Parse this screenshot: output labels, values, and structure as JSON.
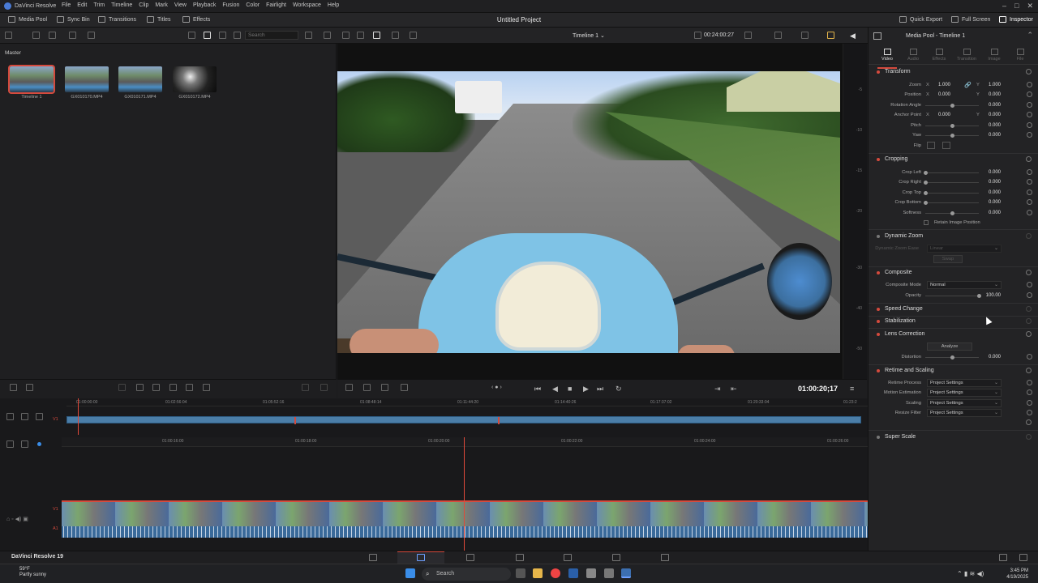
{
  "app": {
    "name": "DaVinci Resolve",
    "project_title": "Untitled Project"
  },
  "menu": [
    "File",
    "Edit",
    "Trim",
    "Timeline",
    "Clip",
    "Mark",
    "View",
    "Playback",
    "Fusion",
    "Color",
    "Fairlight",
    "Workspace",
    "Help"
  ],
  "toolbar": {
    "media_pool": "Media Pool",
    "sync_bin": "Sync Bin",
    "transitions": "Transitions",
    "titles": "Titles",
    "effects": "Effects",
    "quick_export": "Quick Export",
    "full_screen": "Full Screen",
    "inspector": "Inspector"
  },
  "mediapool": {
    "bin": "Master",
    "search_placeholder": "Search",
    "clips": [
      {
        "name": "Timeline 1"
      },
      {
        "name": "GX010170.MP4"
      },
      {
        "name": "GX010171.MP4"
      },
      {
        "name": "GX010172.MP4"
      }
    ]
  },
  "viewer": {
    "timeline_name": "Timeline 1",
    "duration": "00:24:00:27",
    "timecode": "01:00:20;17",
    "ruler": [
      "-5",
      "-10",
      "-15",
      "-20",
      "-30",
      "-40",
      "-50"
    ]
  },
  "inspector": {
    "title": "Media Pool - Timeline 1",
    "tabs": [
      "Video",
      "Audio",
      "Effects",
      "Transition",
      "Image",
      "File"
    ],
    "transform": {
      "header": "Transform",
      "zoom": {
        "label": "Zoom",
        "x": "1.000",
        "y": "1.000"
      },
      "position": {
        "label": "Position",
        "x": "0.000",
        "y": "0.000"
      },
      "rotation": {
        "label": "Rotation Angle",
        "value": "0.000"
      },
      "anchor": {
        "label": "Anchor Point",
        "x": "0.000",
        "y": "0.000"
      },
      "pitch": {
        "label": "Pitch",
        "value": "0.000"
      },
      "yaw": {
        "label": "Yaw",
        "value": "0.000"
      },
      "flip": {
        "label": "Flip"
      }
    },
    "cropping": {
      "header": "Cropping",
      "crop_left": {
        "label": "Crop Left",
        "value": "0.000"
      },
      "crop_right": {
        "label": "Crop Right",
        "value": "0.000"
      },
      "crop_top": {
        "label": "Crop Top",
        "value": "0.000"
      },
      "crop_bottom": {
        "label": "Crop Bottom",
        "value": "0.000"
      },
      "softness": {
        "label": "Softness",
        "value": "0.000"
      },
      "retain": "Retain Image Position"
    },
    "dynamic_zoom": {
      "header": "Dynamic Zoom",
      "ease_label": "Dynamic Zoom Ease",
      "ease_value": "Linear",
      "swap": "Swap"
    },
    "composite": {
      "header": "Composite",
      "mode_label": "Composite Mode",
      "mode_value": "Normal",
      "opacity_label": "Opacity",
      "opacity_value": "100.00"
    },
    "speed_change": "Speed Change",
    "stabilization": "Stabilization",
    "lens": {
      "header": "Lens Correction",
      "analyze": "Analyze",
      "distortion_label": "Distortion",
      "distortion_value": "0.000"
    },
    "retime": {
      "header": "Retime and Scaling",
      "rows": [
        {
          "label": "Retime Process",
          "value": "Project Settings"
        },
        {
          "label": "Motion Estimation",
          "value": "Project Settings"
        },
        {
          "label": "Scaling",
          "value": "Project Settings"
        },
        {
          "label": "Resize Filter",
          "value": "Project Settings"
        }
      ]
    },
    "super_scale": "Super Scale"
  },
  "timeline": {
    "upper_ruler": [
      "01:00:00:00",
      "01:02:56:04",
      "01:05:52:16",
      "01:08:48:14",
      "01:11:44:20",
      "01:14:40:26",
      "01:17:37:02",
      "01:20:33:04",
      "01:23:2"
    ],
    "lower_ruler": [
      "01:00:16:00",
      "01:00:18:00",
      "01:00:20:00",
      "01:00:22:00",
      "01:00:24:00",
      "01:00:26:00"
    ],
    "track_v": "V1",
    "track_a": "A1"
  },
  "pagebar": {
    "brand": "DaVinci Resolve 19"
  },
  "taskbar": {
    "temp": "59°F",
    "weather": "Partly sunny",
    "search": "Search",
    "time": "3:45 PM",
    "date": "4/19/2025"
  }
}
